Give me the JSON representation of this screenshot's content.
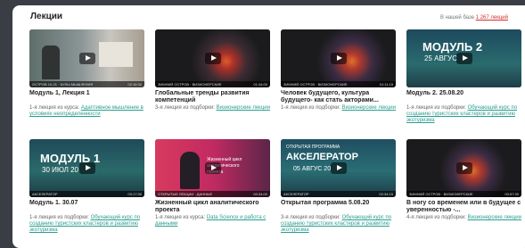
{
  "section_title": "Лекции",
  "base_info": {
    "prefix": "В нашей базе",
    "count": "1 267 лекций"
  },
  "cards": [
    {
      "title": "Модуль 1, Лекция 1",
      "sub_prefix": "1-я лекция из курса:",
      "sub_link": "Адаптивное мышление в условиях неопределенности",
      "bar_left": "ОСТРОВ 10-21 · БУЛЫ МЫШЛЕНИЯ",
      "bar_right": "02:16:32"
    },
    {
      "title": "Глобальные тренды развития компетенций",
      "sub_prefix": "3-я лекция из подборки:",
      "sub_link": "Визионерские лекции",
      "bar_left": "ЗИМНИЙ ОСТРОВ · ВИЗИОНЕРСКИЕ",
      "bar_right": "01:44:00"
    },
    {
      "title": "Человек будущего, культура будущего- как стать акторами...",
      "sub_prefix": "1-я лекция из подборки:",
      "sub_link": "Визионерские лекции",
      "bar_left": "ЗИМНИЙ ОСТРОВ · ВИЗИОНЕРСКИЕ",
      "bar_right": "01:11:15"
    },
    {
      "title": "Модуль 2. 25.08.20",
      "sub_prefix": "1-я лекция из подборки:",
      "sub_link": "Обучающий курс по созданию туристских кластеров и развитию экотуризма",
      "bar_left": "",
      "bar_right": "",
      "big1": "МОДУЛЬ 2",
      "big2": "25 АВГУС"
    },
    {
      "title": "Модуль 1. 30.07",
      "sub_prefix": "1-я лекция из подборки:",
      "sub_link": "Обучающий курс по созданию туристских кластеров и развитию экотуризма",
      "bar_left": "АКСЕЛЕРАТОР",
      "bar_right": "03:17:30",
      "big1": "МОДУЛЬ 1",
      "big2": "30 ИЮЛ 20"
    },
    {
      "title": "Жизненный цикл аналитического проекта",
      "sub_prefix": "1-я лекция из курса:",
      "sub_link": "Data Science и работа с данными",
      "bar_left": "ОТКРЫТЫЕ ЛЕКЦИИ · ДАННЫЕ",
      "bar_right": "00:34:00",
      "big1": "Жизненный цикл",
      "big2": "аналитического",
      "big3": "проекта"
    },
    {
      "title": "Открытая программа 5.08.20",
      "sub_prefix": "3-я лекция из подборки:",
      "sub_link": "Обучающий курс по созданию туристских кластеров и развитию экотуризма",
      "bar_left": "АКСЕЛЕРАТОР",
      "bar_right": "02:34:15",
      "big1": "ОТКРЫТАЯ ПРОГРАММА",
      "big2": "АКСЕЛЕРАТОР",
      "big3": "05 АВГУС 20"
    },
    {
      "title": "В ногу со временем или в будущее с уверенностью -...",
      "sub_prefix": "4-я лекция из подборки:",
      "sub_link": "Визионерские лекции",
      "bar_left": "ЗИМНИЙ ОСТРОВ · ВИЗИОНЕРСКИЕ",
      "bar_right": "00:57:30"
    }
  ]
}
